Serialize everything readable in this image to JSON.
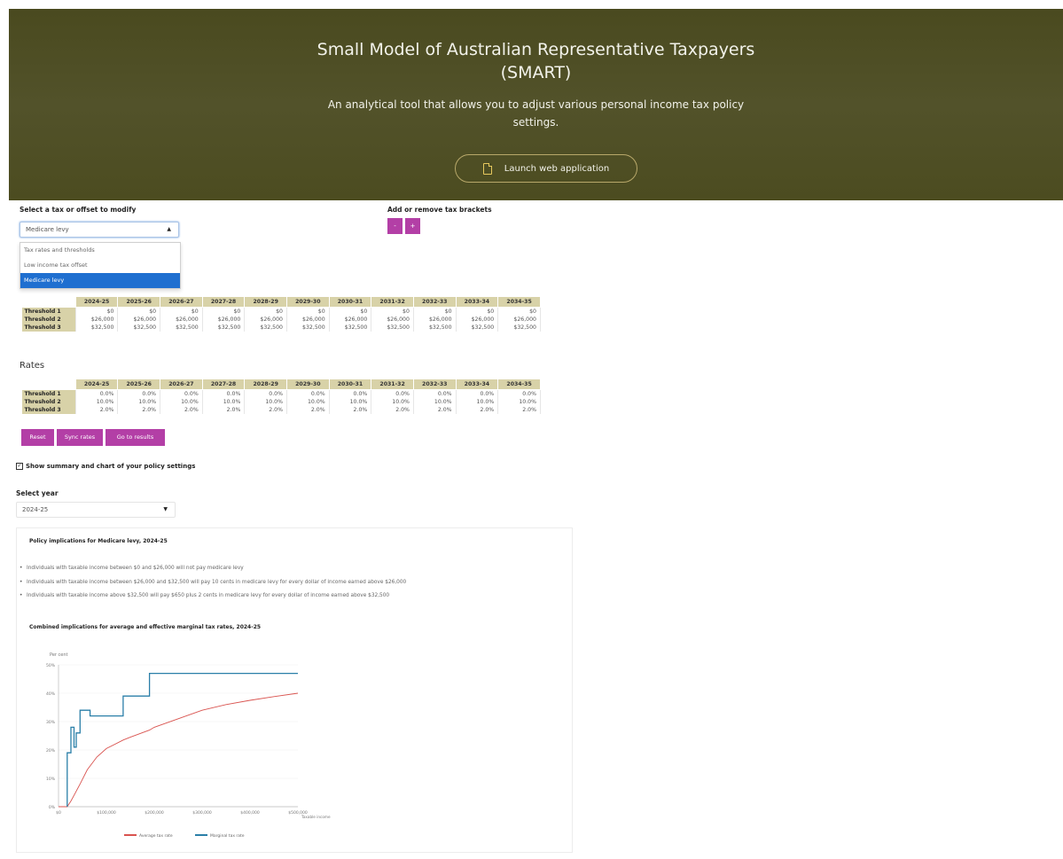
{
  "header": {
    "title_line1": "Small Model of Australian Representative Taxpayers",
    "title_line2": "(SMART)",
    "subtitle_line1": "An analytical tool that allows you to adjust various personal income tax policy",
    "subtitle_line2": "settings.",
    "launch_label": "Launch web application",
    "icon": "document-icon"
  },
  "controls": {
    "modify_label": "Select a tax or offset to modify",
    "modify_value": "Medicare levy",
    "modify_options": [
      "Tax rates and thresholds",
      "Low income tax offset",
      "Medicare levy"
    ],
    "brackets_label": "Add or remove tax brackets",
    "minus_label": "-",
    "plus_label": "+"
  },
  "thresholds": {
    "years": [
      "2024-25",
      "2025-26",
      "2026-27",
      "2027-28",
      "2028-29",
      "2029-30",
      "2030-31",
      "2031-32",
      "2032-33",
      "2033-34",
      "2034-35"
    ],
    "rows": [
      {
        "label": "Threshold 1",
        "values": [
          "$0",
          "$0",
          "$0",
          "$0",
          "$0",
          "$0",
          "$0",
          "$0",
          "$0",
          "$0",
          "$0"
        ]
      },
      {
        "label": "Threshold 2",
        "values": [
          "$26,000",
          "$26,000",
          "$26,000",
          "$26,000",
          "$26,000",
          "$26,000",
          "$26,000",
          "$26,000",
          "$26,000",
          "$26,000",
          "$26,000"
        ]
      },
      {
        "label": "Threshold 3",
        "values": [
          "$32,500",
          "$32,500",
          "$32,500",
          "$32,500",
          "$32,500",
          "$32,500",
          "$32,500",
          "$32,500",
          "$32,500",
          "$32,500",
          "$32,500"
        ]
      }
    ]
  },
  "rates": {
    "title": "Rates",
    "years": [
      "2024-25",
      "2025-26",
      "2026-27",
      "2027-28",
      "2028-29",
      "2029-30",
      "2030-31",
      "2031-32",
      "2032-33",
      "2033-34",
      "2034-35"
    ],
    "rows": [
      {
        "label": "Threshold 1",
        "values": [
          "0.0%",
          "0.0%",
          "0.0%",
          "0.0%",
          "0.0%",
          "0.0%",
          "0.0%",
          "0.0%",
          "0.0%",
          "0.0%",
          "0.0%"
        ]
      },
      {
        "label": "Threshold 2",
        "values": [
          "10.0%",
          "10.0%",
          "10.0%",
          "10.0%",
          "10.0%",
          "10.0%",
          "10.0%",
          "10.0%",
          "10.0%",
          "10.0%",
          "10.0%"
        ]
      },
      {
        "label": "Threshold 3",
        "values": [
          "2.0%",
          "2.0%",
          "2.0%",
          "2.0%",
          "2.0%",
          "2.0%",
          "2.0%",
          "2.0%",
          "2.0%",
          "2.0%",
          "2.0%"
        ]
      }
    ]
  },
  "buttons": {
    "reset": "Reset",
    "sync": "Sync rates",
    "results": "Go to results"
  },
  "summary_toggle": {
    "checked": true,
    "label": "Show summary and chart of your policy settings"
  },
  "year_select": {
    "label": "Select year",
    "value": "2024-25"
  },
  "panel": {
    "policy_heading": "Policy implications for Medicare levy, 2024-25",
    "bullets": [
      "Individuals with taxable income between $0 and $26,000 will not pay medicare levy",
      "Individuals with taxable income between $26,000 and $32,500 will pay 10 cents in medicare levy for every dollar of income earned above $26,000",
      "Individuals with taxable income above $32,500 will pay $650 plus 2 cents in medicare levy for every dollar of income earned above $32,500"
    ],
    "chart_heading": "Combined implications for average and effective marginal tax rates, 2024-25"
  },
  "colors": {
    "header_bg": "#4e4e22",
    "accent_magenta": "#b33fa6",
    "table_header": "#d8d2a8",
    "avg_line": "#d9534f",
    "marginal_line": "#2a7fa8"
  },
  "chart_data": {
    "type": "line",
    "ylabel": "Per cent",
    "xlabel": "Taxable income",
    "ylim": [
      0,
      50
    ],
    "xlim": [
      0,
      500000
    ],
    "yticks": [
      "0%",
      "10%",
      "20%",
      "30%",
      "40%",
      "50%"
    ],
    "xticks": [
      "$0",
      "$100,000",
      "$200,000",
      "$300,000",
      "$400,000",
      "$500,000"
    ],
    "series": [
      {
        "name": "Average tax rate",
        "color": "#d9534f",
        "points": [
          [
            0,
            0
          ],
          [
            18200,
            0
          ],
          [
            26000,
            2
          ],
          [
            32500,
            4
          ],
          [
            45000,
            8
          ],
          [
            60000,
            13
          ],
          [
            80000,
            17.5
          ],
          [
            100000,
            20.5
          ],
          [
            135000,
            23.5
          ],
          [
            150000,
            24.5
          ],
          [
            190000,
            27
          ],
          [
            200000,
            28
          ],
          [
            250000,
            31
          ],
          [
            300000,
            34
          ],
          [
            350000,
            36
          ],
          [
            400000,
            37.5
          ],
          [
            450000,
            38.8
          ],
          [
            500000,
            40
          ]
        ]
      },
      {
        "name": "Marginal tax rate",
        "color": "#2a7fa8",
        "points": [
          [
            18199,
            0
          ],
          [
            18200,
            19
          ],
          [
            26000,
            19
          ],
          [
            26000,
            28
          ],
          [
            32500,
            28
          ],
          [
            32500,
            21
          ],
          [
            37000,
            21
          ],
          [
            37000,
            26
          ],
          [
            45000,
            26
          ],
          [
            45000,
            34
          ],
          [
            66000,
            34
          ],
          [
            66000,
            32
          ],
          [
            135000,
            32
          ],
          [
            135000,
            39
          ],
          [
            190000,
            39
          ],
          [
            190000,
            47
          ],
          [
            500000,
            47
          ]
        ]
      }
    ]
  }
}
